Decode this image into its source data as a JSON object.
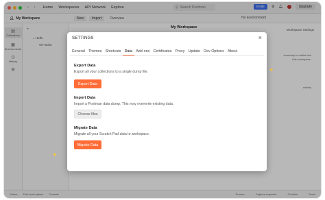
{
  "titlebar": {
    "home": "Home",
    "workspaces": "Workspaces",
    "api_network": "API Network",
    "explore": "Explore",
    "search_placeholder": "Search Postman",
    "invite": "Invite",
    "upgrade": "Upgrade"
  },
  "wsbar": {
    "workspace_name": "My Workspace",
    "new_label": "New",
    "import_label": "Import",
    "overview_tab": "Overview",
    "environment": "No Environment"
  },
  "sidebar": {
    "items": [
      {
        "label": "Collections",
        "icon": "collections-icon"
      },
      {
        "label": "Environments",
        "icon": "environments-icon"
      },
      {
        "label": "History",
        "icon": "history-icon"
      }
    ]
  },
  "tree": {
    "collection": "Hello",
    "request": "Echo",
    "method": "WF"
  },
  "main": {
    "header": "My Workspace",
    "settings_link": "Workspace Settings",
    "side_lines": [
      "summary to outline the",
      "this workspace.",
      "activity"
    ]
  },
  "statusbar": {
    "left": [
      "Online",
      "Find and replace",
      "Console"
    ],
    "right": [
      "Runner",
      "Capture requests",
      "Cookies",
      "Trash"
    ]
  },
  "modal": {
    "title": "SETTINGS",
    "close": "×",
    "tabs": [
      "General",
      "Themes",
      "Shortcuts",
      "Data",
      "Add-ons",
      "Certificates",
      "Proxy",
      "Update",
      "Dev Options",
      "About"
    ],
    "active_tab": "Data",
    "export": {
      "title": "Export Data",
      "desc": "Export all your collections to a single dump file.",
      "button": "Export Data"
    },
    "import": {
      "title": "Import Data",
      "desc": "Import a Postman data dump. This may overwrite existing data.",
      "button": "Choose files"
    },
    "migrate": {
      "title": "Migrate Data",
      "desc": "Migrate all your Scratch Pad data to workspace.",
      "button": "Migrate Data"
    }
  },
  "colors": {
    "accent": "#ff6c37",
    "invite": "#3d6ef0"
  }
}
